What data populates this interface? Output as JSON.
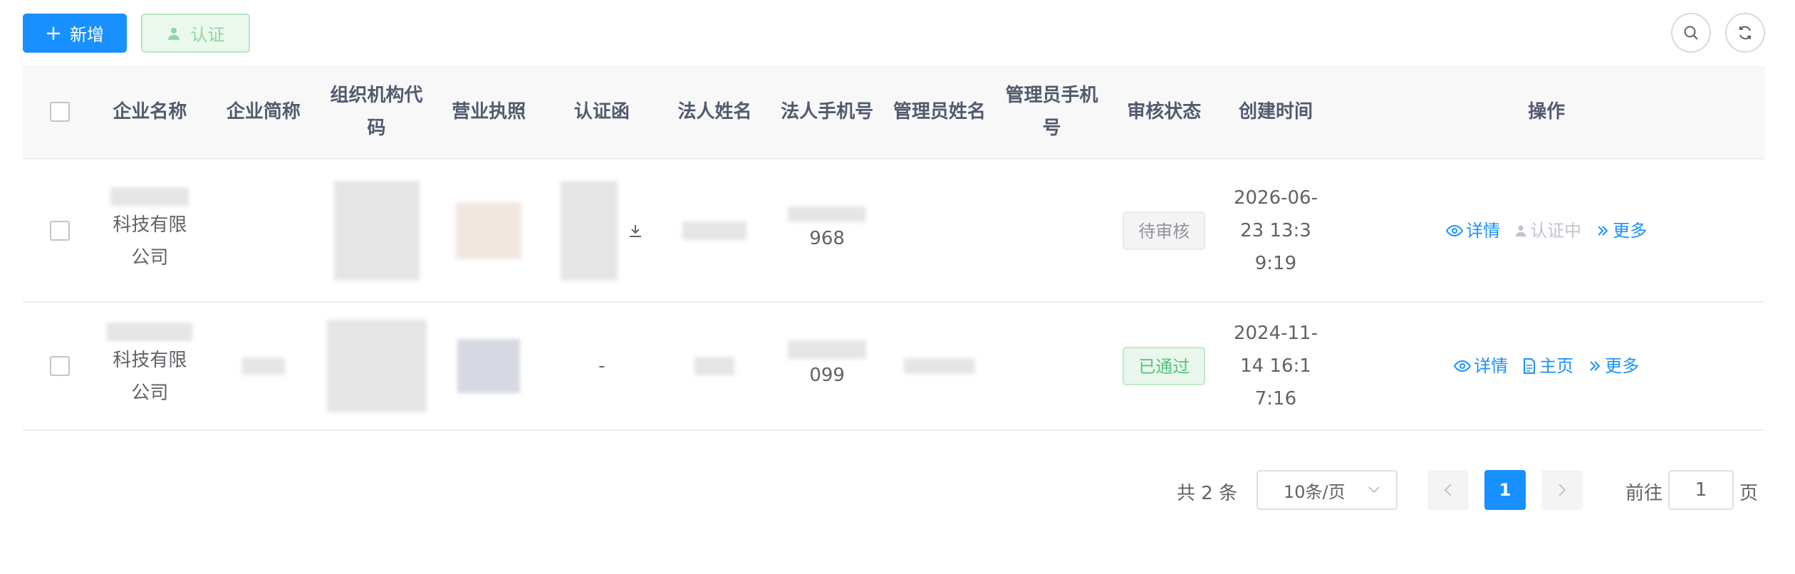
{
  "toolbar": {
    "add_label": "新增",
    "auth_label": "认证"
  },
  "table": {
    "headers": {
      "name": "企业名称",
      "short": "企业简称",
      "org_code": "组织机构代码",
      "license": "营业执照",
      "letter": "认证函",
      "legal_name": "法人姓名",
      "legal_phone": "法人手机号",
      "admin_name": "管理员姓名",
      "admin_phone": "管理员手机号",
      "status": "审核状态",
      "created": "创建时间",
      "ops": "操作"
    },
    "rows": [
      {
        "name": "科技有限公司",
        "letter": "",
        "legal_phone": "968",
        "status": "待审核",
        "created": "2026-06-23 13:39:19",
        "ops": {
          "detail": "详情",
          "second": "认证中",
          "more": "更多"
        }
      },
      {
        "name": "科技有限公司",
        "letter": "-",
        "legal_phone": "099",
        "status": "已通过",
        "created": "2024-11-14 16:17:16",
        "ops": {
          "detail": "详情",
          "second": "主页",
          "more": "更多"
        }
      }
    ]
  },
  "pagination": {
    "total": "共 2 条",
    "page_size": "10条/页",
    "current_page": "1",
    "goto_label": "前往",
    "goto_value": "1",
    "goto_suffix": "页"
  },
  "colors": {
    "primary": "#1890ff",
    "success": "#52c47a",
    "muted": "#909399"
  }
}
